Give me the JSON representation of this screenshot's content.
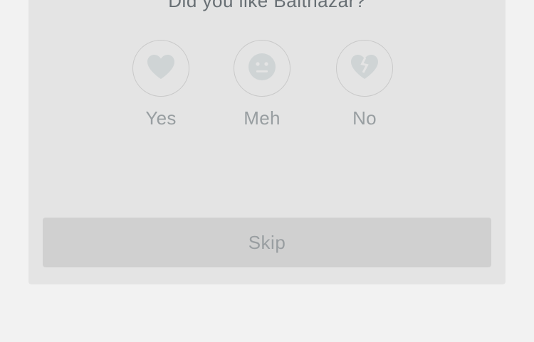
{
  "prompt": {
    "question": "Did you like Balthazar?"
  },
  "options": [
    {
      "label": "Yes",
      "icon": "heart-icon"
    },
    {
      "label": "Meh",
      "icon": "neutral-face-icon"
    },
    {
      "label": "No",
      "icon": "broken-heart-icon"
    }
  ],
  "actions": {
    "skip_label": "Skip"
  },
  "colors": {
    "page_background": "#f2f2f2",
    "card_background": "#e4e4e4",
    "icon_fill": "#cfd4d5",
    "button_background": "#d0d0d0",
    "muted_text": "#989ea1",
    "question_text": "#686f74"
  }
}
